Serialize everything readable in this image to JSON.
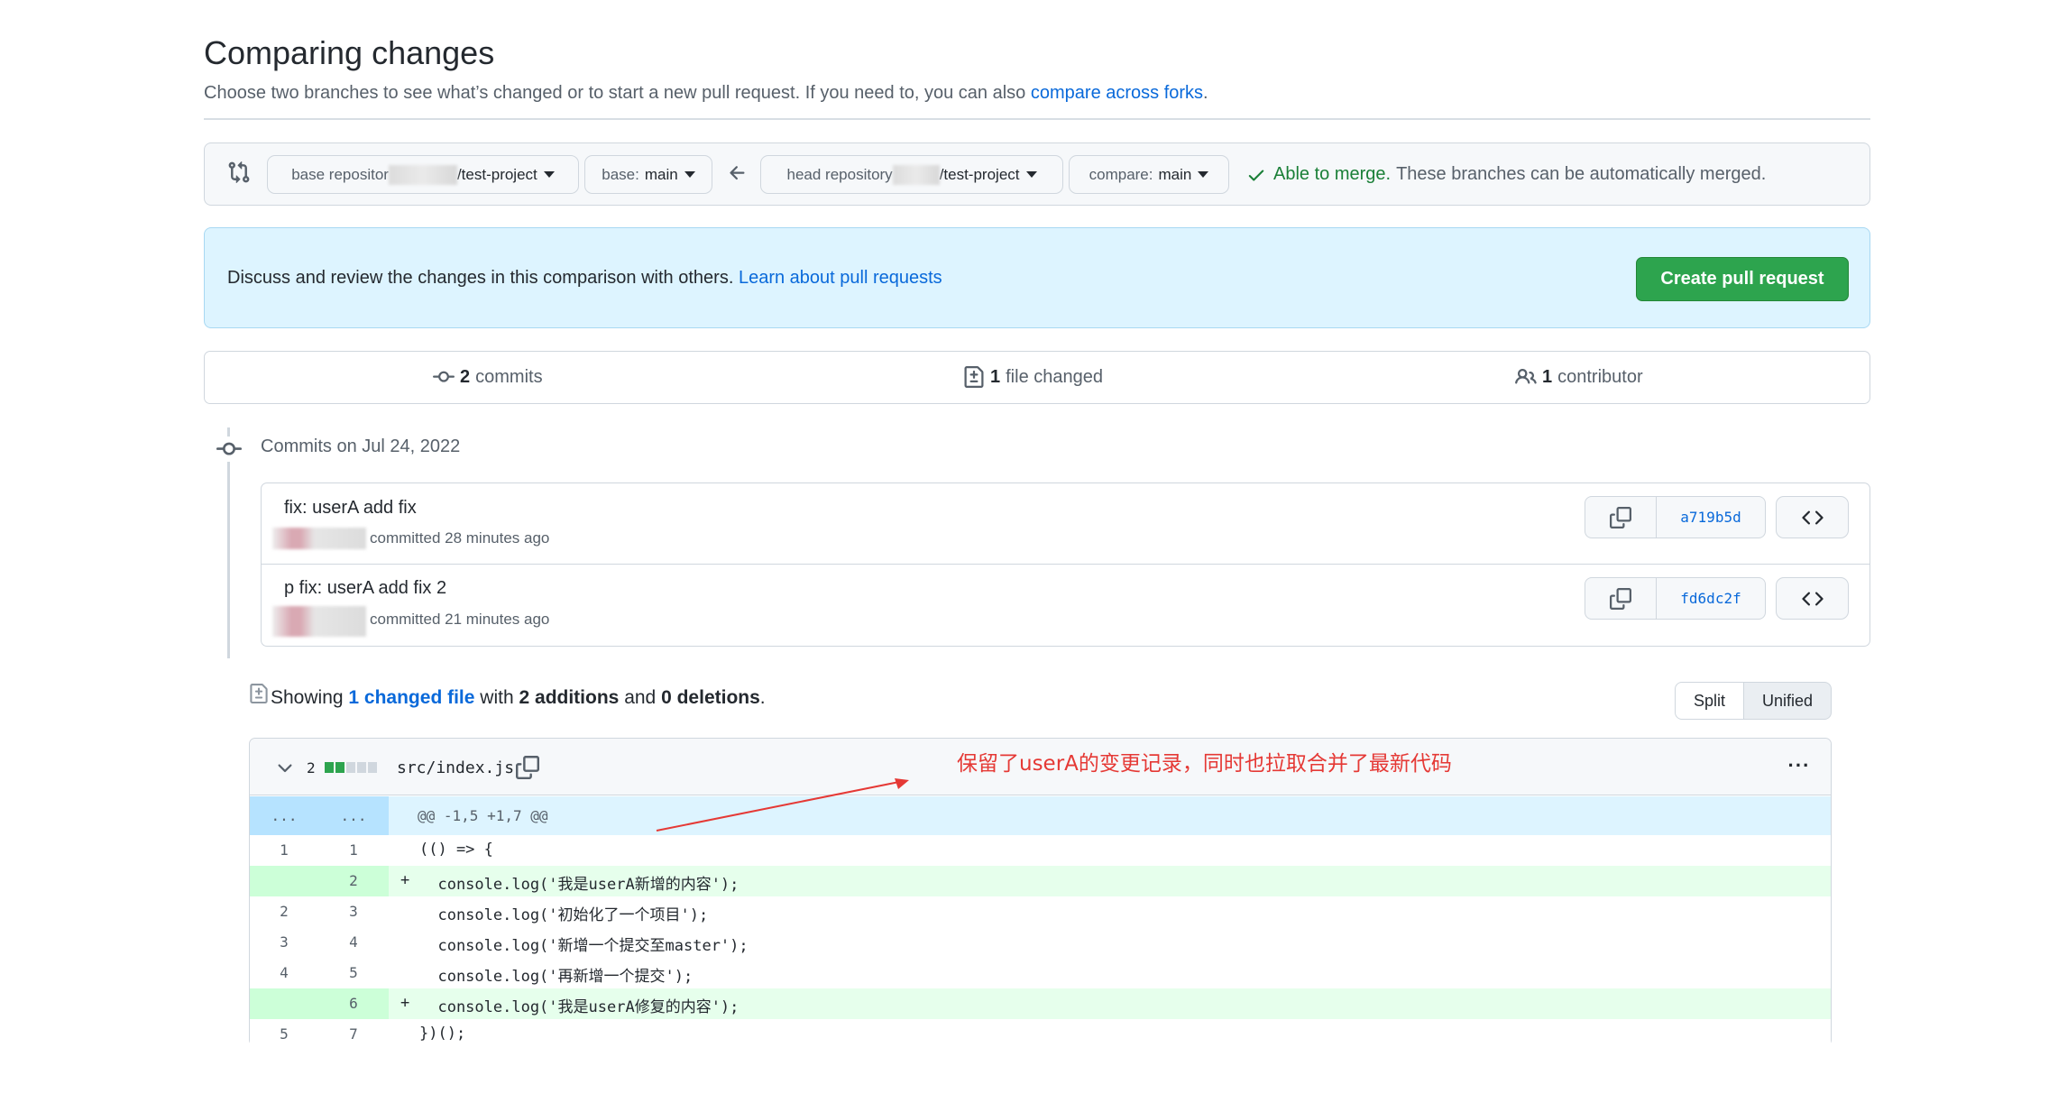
{
  "header": {
    "title": "Comparing changes",
    "subtitle": "Choose two branches to see what’s changed or to start a new pull request. If you need to, you can also",
    "subtitle_link": "compare across forks",
    "subtitle_end": "."
  },
  "range": {
    "base_repo_prefix": "base repositor",
    "base_repo_suffix": "/test-project",
    "base_branch_label": "base:",
    "base_branch": "main",
    "head_repo_prefix": "head repository",
    "head_repo_suffix": "/test-project",
    "compare_label": "compare:",
    "compare_branch": "main",
    "merge_status": "Able to merge.",
    "merge_message": "These branches can be automatically merged."
  },
  "discuss": {
    "text": "Discuss and review the changes in this comparison with others.",
    "link": "Learn about pull requests",
    "button": "Create pull request"
  },
  "summary": {
    "commits_count": "2",
    "commits_label": "commits",
    "files_count": "1",
    "files_label": "file changed",
    "contributors_count": "1",
    "contributors_label": "contributor"
  },
  "commits_header": "Commits on Jul 24, 2022",
  "commits": [
    {
      "title": "fix: userA add fix",
      "meta": "committed 28 minutes ago",
      "sha": "a719b5d"
    },
    {
      "title": "p fix: userA add fix 2",
      "meta": "committed 21 minutes ago",
      "sha": "fd6dc2f"
    }
  ],
  "showing": {
    "prefix": "Showing",
    "link": "1 changed file",
    "with": "with",
    "additions": "2 additions",
    "and": "and",
    "deletions": "0 deletions",
    "end": "."
  },
  "view_toggle": {
    "split": "Split",
    "unified": "Unified"
  },
  "file": {
    "change_count": "2",
    "path": "src/index.js",
    "annotation": "保留了userA的变更记录，同时也拉取合并了最新代码",
    "hunk_left": "...",
    "hunk_right": "...",
    "hunk": "@@ -1,5 +1,7 @@",
    "menu": "···"
  },
  "diff_lines": [
    {
      "old": "1",
      "new": "1",
      "sign": "",
      "code": "(() => {",
      "added": false
    },
    {
      "old": "",
      "new": "2",
      "sign": "+",
      "code": "  console.log('我是userA新增的内容');",
      "added": true
    },
    {
      "old": "2",
      "new": "3",
      "sign": "",
      "code": "  console.log('初始化了一个项目');",
      "added": false
    },
    {
      "old": "3",
      "new": "4",
      "sign": "",
      "code": "  console.log('新增一个提交至master');",
      "added": false
    },
    {
      "old": "4",
      "new": "5",
      "sign": "",
      "code": "  console.log('再新增一个提交');",
      "added": false
    },
    {
      "old": "",
      "new": "6",
      "sign": "+",
      "code": "  console.log('我是userA修复的内容');",
      "added": true
    },
    {
      "old": "5",
      "new": "7",
      "sign": "",
      "code": "})();",
      "added": false
    }
  ],
  "colors": {
    "link": "#0969da",
    "primary_button": "#2da44e",
    "added_line_bg": "#e6ffec",
    "added_num_bg": "#ccffd8",
    "hunk_bg": "#ddf4ff",
    "annotation": "#e53935"
  }
}
